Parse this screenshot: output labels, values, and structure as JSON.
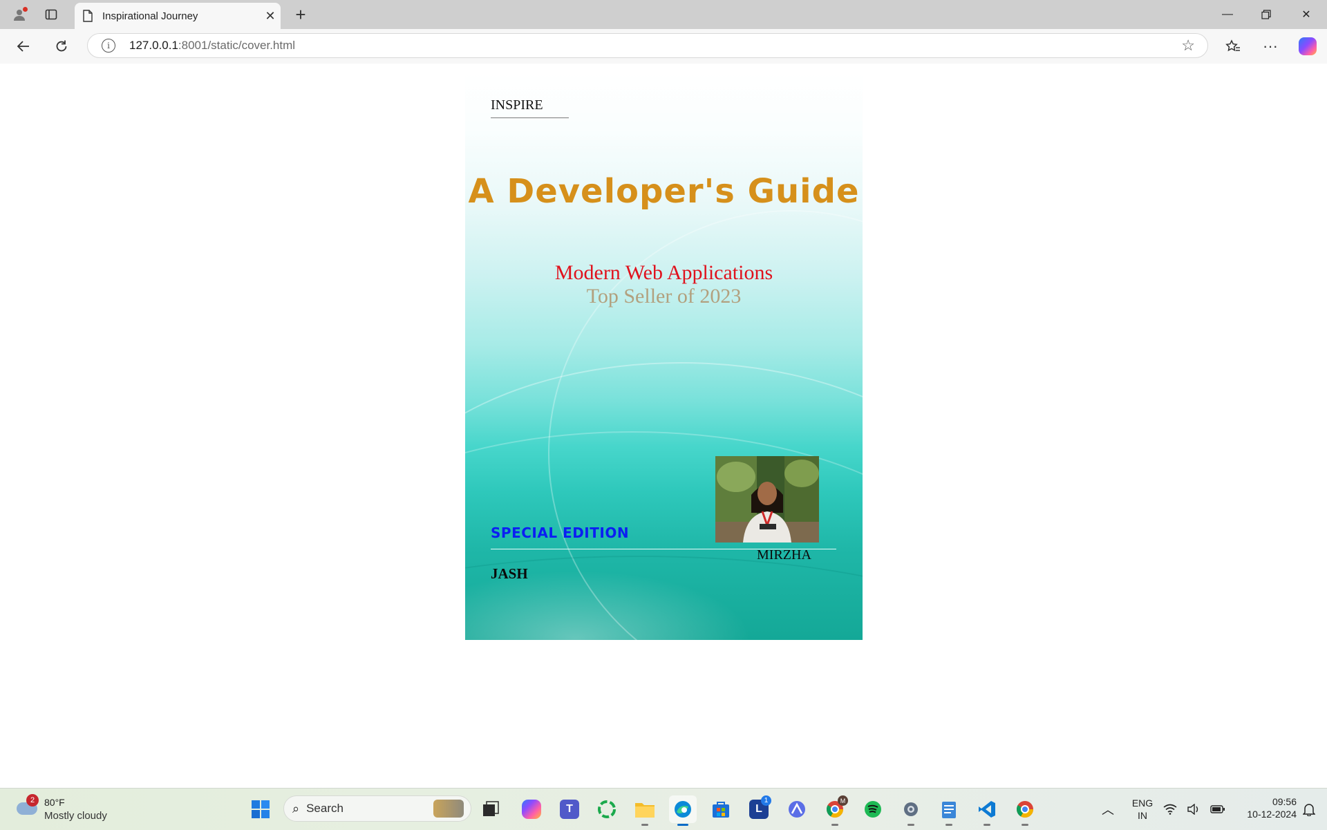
{
  "browser": {
    "tab_title": "Inspirational Journey",
    "url_host": "127.0.0.1",
    "url_rest": ":8001/static/cover.html"
  },
  "cover": {
    "brand": "INSPIRE",
    "title": "A Developer's Guide",
    "subtitle": "Modern Web Applications",
    "tagline": "Top Seller of 2023",
    "edition": "SPECIAL EDITION",
    "author_left": "JASH",
    "author_right": "MIRZHA",
    "colors": {
      "title": "#d6901b",
      "subtitle": "#e0121d",
      "tagline": "#b2a07e",
      "edition": "#0b1ef2"
    }
  },
  "taskbar": {
    "weather_badge": "2",
    "weather_temp": "80°F",
    "weather_cond": "Mostly cloudy",
    "search_label": "Search",
    "apps": [
      "windows-start",
      "task-view",
      "copilot",
      "teams",
      "green-circle-app",
      "file-explorer",
      "edge",
      "microsoft-store",
      "l-app",
      "arc-app",
      "chrome-profile",
      "spotify",
      "settings",
      "notepad",
      "vscode",
      "chrome"
    ],
    "l_app_badge": "1",
    "chrome_badge": "M",
    "lang_top": "ENG",
    "lang_bottom": "IN",
    "time": "09:56",
    "date": "10-12-2024"
  }
}
